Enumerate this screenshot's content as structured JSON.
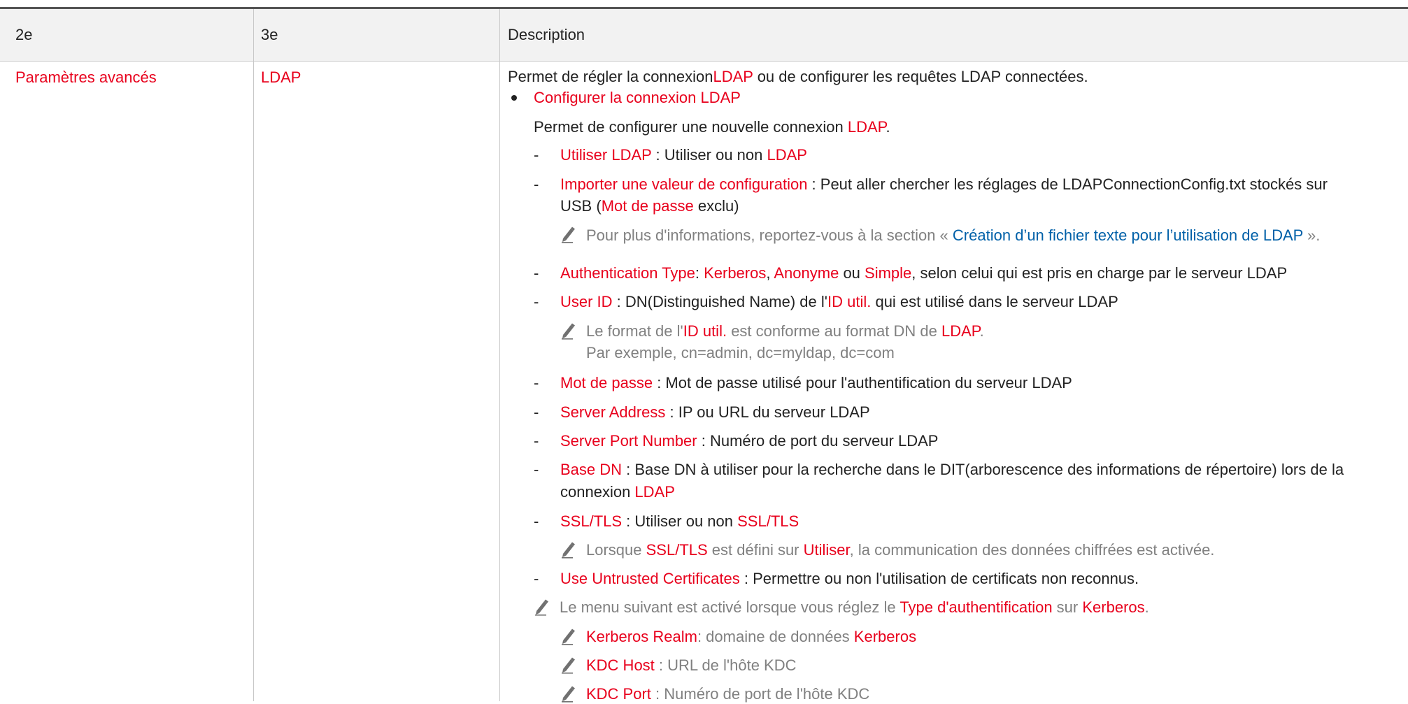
{
  "table": {
    "headers": [
      "2e",
      "3e",
      "Description"
    ],
    "row": {
      "col1": "Paramètres avancés",
      "col2": "LDAP",
      "intro": {
        "a": "Permet de régler la connexion",
        "b": "LDAP",
        "c": " ou de configurer les requêtes LDAP connectées."
      },
      "bullet": {
        "title": "Configurer la connexion LDAP",
        "desc": {
          "a": "Permet de configurer une nouvelle connexion ",
          "b": "LDAP",
          "c": "."
        },
        "items": {
          "utiliser": {
            "k": "Utiliser LDAP",
            "t": " : Utiliser ou non ",
            "v": "LDAP"
          },
          "importer": {
            "k": "Importer une valeur de configuration",
            "t": " : Peut aller chercher les réglages de LDAPConnectionConfig.txt stockés sur",
            "t2a": "USB (",
            "t2b": "Mot de passe",
            "t2c": " exclu)"
          },
          "importer_note": {
            "a": "Pour plus d'informations, reportez-vous à la section « ",
            "b": "Création d’un fichier texte pour l’utilisation de LDAP",
            "c": " »."
          },
          "auth": {
            "k": "Authentication Type",
            "t1": ": ",
            "v1": "Kerberos",
            "t2": ", ",
            "v2": "Anonyme",
            "t3": " ou ",
            "v3": "Simple",
            "t4": ", selon celui qui est pris en charge par le serveur LDAP"
          },
          "userid": {
            "k": "User ID",
            "t1": " : DN(Distinguished Name) de l'",
            "v": "ID util.",
            "t2": " qui est utilisé dans le serveur LDAP"
          },
          "userid_note": {
            "a": "Le format de l'",
            "b": "ID util.",
            "c": " est conforme au format DN de ",
            "d": "LDAP",
            "e": ".",
            "line2": "Par exemple, cn=admin, dc=myldap, dc=com"
          },
          "mdp": {
            "k": "Mot de passe",
            "t": " : Mot de passe utilisé pour l'authentification du serveur LDAP"
          },
          "server": {
            "k": "Server Address",
            "t": " : IP ou URL du serveur LDAP"
          },
          "port": {
            "k": "Server Port Number",
            "t": " : Numéro de port du serveur LDAP"
          },
          "basedn": {
            "k": "Base DN",
            "t": " : Base DN à utiliser pour la recherche dans le DIT(arborescence des informations de répertoire) lors de la",
            "t2a": "connexion ",
            "t2b": "LDAP"
          },
          "ssl": {
            "k": "SSL/TLS",
            "t": " : Utiliser ou non ",
            "v": "SSL/TLS"
          },
          "ssl_note": {
            "a": "Lorsque ",
            "b": "SSL/TLS",
            "c": " est défini sur ",
            "d": "Utiliser",
            "e": ", la communication des données chiffrées est activée."
          },
          "untrusted": {
            "k": "Use Untrusted Certificates",
            "t": " : Permettre ou non l'utilisation de certificats non reconnus."
          }
        },
        "kerberos_note": {
          "a": "Le menu suivant est activé lorsque vous réglez le ",
          "b": "Type d'authentification",
          "c": " sur ",
          "d": "Kerberos",
          "e": "."
        },
        "kerb_items": {
          "realm": {
            "k": "Kerberos Realm",
            "t": ": domaine de données ",
            "v": "Kerberos"
          },
          "kdchost": {
            "k": "KDC Host",
            "t": " : URL de l'hôte KDC"
          },
          "kdcport": {
            "k": "KDC Port",
            "t": " : Numéro de port de l'hôte KDC"
          }
        }
      }
    }
  },
  "colors": {
    "accent_red": "#e8001c",
    "link_blue": "#0060a8",
    "note_grey": "#808080",
    "header_bg": "#f2f2f2"
  },
  "icons": [
    "bullet-dot",
    "note-pencil-icon"
  ]
}
